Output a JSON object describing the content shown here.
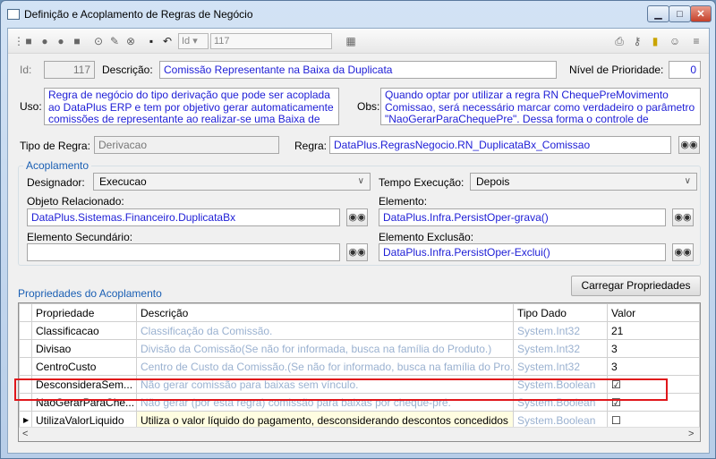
{
  "window": {
    "title": "Definição e Acoplamento de Regras de Negócio"
  },
  "toolbar": {
    "id_label": "Id",
    "id_value": "117"
  },
  "form": {
    "id_label": "Id:",
    "id_value": "117",
    "descricao_label": "Descrição:",
    "descricao_value": "Comissão Representante na Baixa da Duplicata",
    "prioridade_label": "Nível de Prioridade:",
    "prioridade_value": "0",
    "uso_label": "Uso:",
    "uso_text": "Regra de negócio do tipo derivação que pode ser acoplada ao DataPlus ERP e tem por objetivo gerar automaticamente comissões de representante ao realizar-se uma Baixa de",
    "obs_label": "Obs:",
    "obs_text": "Quando optar por utilizar a regra RN ChequePreMovimento Comissao, será necessário marcar como verdadeiro o parâmetro \"NaoGerarParaChequePre\". Dessa forma o controle de comissão",
    "tipo_label": "Tipo de Regra:",
    "tipo_value": "Derivacao",
    "regra_label": "Regra:",
    "regra_value": "DataPlus.RegrasNegocio.RN_DuplicataBx_Comissao"
  },
  "acoplamento": {
    "title": "Acoplamento",
    "designador_label": "Designador:",
    "designador_value": "Execucao",
    "tempo_label": "Tempo Execução:",
    "tempo_value": "Depois",
    "objeto_label": "Objeto Relacionado:",
    "objeto_value": "DataPlus.Sistemas.Financeiro.DuplicataBx",
    "elemento_label": "Elemento:",
    "elemento_value": "DataPlus.Infra.PersistOper-grava()",
    "secundario_label": "Elemento Secundário:",
    "secundario_value": "",
    "exclusao_label": "Elemento Exclusão:",
    "exclusao_value": "DataPlus.Infra.PersistOper-Exclui()"
  },
  "props": {
    "title": "Propriedades do Acoplamento",
    "load_button": "Carregar Propriedades",
    "columns": [
      "Propriedade",
      "Descrição",
      "Tipo Dado",
      "Valor"
    ],
    "rows": [
      {
        "prop": "Classificacao",
        "desc": "Classificação da Comissão.",
        "tipo": "System.Int32",
        "valor": "21"
      },
      {
        "prop": "Divisao",
        "desc": "Divisão da Comissão(Se não for informada, busca na família do Produto.)",
        "tipo": "System.Int32",
        "valor": "3"
      },
      {
        "prop": "CentroCusto",
        "desc": "Centro de Custo da Comissão.(Se não for informado, busca na família do Pro...",
        "tipo": "System.Int32",
        "valor": "3"
      },
      {
        "prop": "DesconsideraSem...",
        "desc": "Não gerar comissão para baixas sem vínculo.",
        "tipo": "System.Boolean",
        "valor": "☑"
      },
      {
        "prop": "NaoGerarParaChe...",
        "desc": "Não gerar (por esta regra) comissão para baixas por cheque-pré.",
        "tipo": "System.Boolean",
        "valor": "☑"
      },
      {
        "prop": "UtilizaValorLiquido",
        "desc": "Utiliza o valor líquido do pagamento, desconsiderando descontos concedidos",
        "tipo": "System.Boolean",
        "valor": "☐"
      }
    ]
  }
}
